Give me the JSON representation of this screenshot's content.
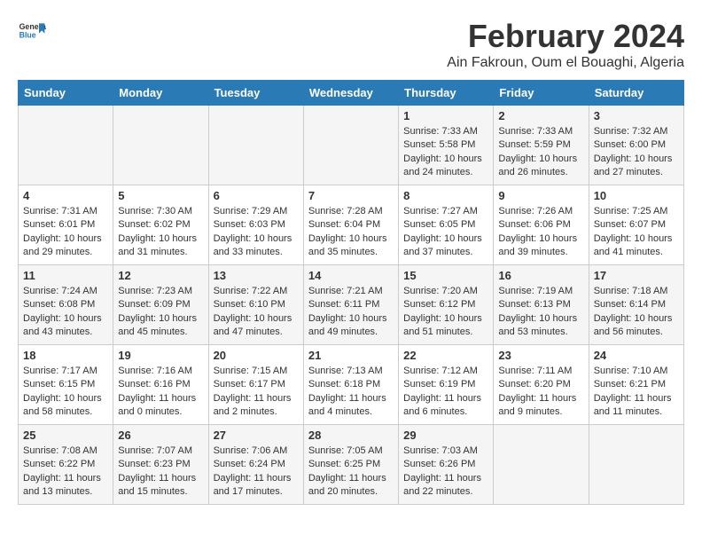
{
  "header": {
    "logo_general": "General",
    "logo_blue": "Blue",
    "title": "February 2024",
    "subtitle": "Ain Fakroun, Oum el Bouaghi, Algeria"
  },
  "weekdays": [
    "Sunday",
    "Monday",
    "Tuesday",
    "Wednesday",
    "Thursday",
    "Friday",
    "Saturday"
  ],
  "weeks": [
    [
      {
        "day": "",
        "sunrise": "",
        "sunset": "",
        "daylight": ""
      },
      {
        "day": "",
        "sunrise": "",
        "sunset": "",
        "daylight": ""
      },
      {
        "day": "",
        "sunrise": "",
        "sunset": "",
        "daylight": ""
      },
      {
        "day": "",
        "sunrise": "",
        "sunset": "",
        "daylight": ""
      },
      {
        "day": "1",
        "sunrise": "Sunrise: 7:33 AM",
        "sunset": "Sunset: 5:58 PM",
        "daylight": "Daylight: 10 hours and 24 minutes."
      },
      {
        "day": "2",
        "sunrise": "Sunrise: 7:33 AM",
        "sunset": "Sunset: 5:59 PM",
        "daylight": "Daylight: 10 hours and 26 minutes."
      },
      {
        "day": "3",
        "sunrise": "Sunrise: 7:32 AM",
        "sunset": "Sunset: 6:00 PM",
        "daylight": "Daylight: 10 hours and 27 minutes."
      }
    ],
    [
      {
        "day": "4",
        "sunrise": "Sunrise: 7:31 AM",
        "sunset": "Sunset: 6:01 PM",
        "daylight": "Daylight: 10 hours and 29 minutes."
      },
      {
        "day": "5",
        "sunrise": "Sunrise: 7:30 AM",
        "sunset": "Sunset: 6:02 PM",
        "daylight": "Daylight: 10 hours and 31 minutes."
      },
      {
        "day": "6",
        "sunrise": "Sunrise: 7:29 AM",
        "sunset": "Sunset: 6:03 PM",
        "daylight": "Daylight: 10 hours and 33 minutes."
      },
      {
        "day": "7",
        "sunrise": "Sunrise: 7:28 AM",
        "sunset": "Sunset: 6:04 PM",
        "daylight": "Daylight: 10 hours and 35 minutes."
      },
      {
        "day": "8",
        "sunrise": "Sunrise: 7:27 AM",
        "sunset": "Sunset: 6:05 PM",
        "daylight": "Daylight: 10 hours and 37 minutes."
      },
      {
        "day": "9",
        "sunrise": "Sunrise: 7:26 AM",
        "sunset": "Sunset: 6:06 PM",
        "daylight": "Daylight: 10 hours and 39 minutes."
      },
      {
        "day": "10",
        "sunrise": "Sunrise: 7:25 AM",
        "sunset": "Sunset: 6:07 PM",
        "daylight": "Daylight: 10 hours and 41 minutes."
      }
    ],
    [
      {
        "day": "11",
        "sunrise": "Sunrise: 7:24 AM",
        "sunset": "Sunset: 6:08 PM",
        "daylight": "Daylight: 10 hours and 43 minutes."
      },
      {
        "day": "12",
        "sunrise": "Sunrise: 7:23 AM",
        "sunset": "Sunset: 6:09 PM",
        "daylight": "Daylight: 10 hours and 45 minutes."
      },
      {
        "day": "13",
        "sunrise": "Sunrise: 7:22 AM",
        "sunset": "Sunset: 6:10 PM",
        "daylight": "Daylight: 10 hours and 47 minutes."
      },
      {
        "day": "14",
        "sunrise": "Sunrise: 7:21 AM",
        "sunset": "Sunset: 6:11 PM",
        "daylight": "Daylight: 10 hours and 49 minutes."
      },
      {
        "day": "15",
        "sunrise": "Sunrise: 7:20 AM",
        "sunset": "Sunset: 6:12 PM",
        "daylight": "Daylight: 10 hours and 51 minutes."
      },
      {
        "day": "16",
        "sunrise": "Sunrise: 7:19 AM",
        "sunset": "Sunset: 6:13 PM",
        "daylight": "Daylight: 10 hours and 53 minutes."
      },
      {
        "day": "17",
        "sunrise": "Sunrise: 7:18 AM",
        "sunset": "Sunset: 6:14 PM",
        "daylight": "Daylight: 10 hours and 56 minutes."
      }
    ],
    [
      {
        "day": "18",
        "sunrise": "Sunrise: 7:17 AM",
        "sunset": "Sunset: 6:15 PM",
        "daylight": "Daylight: 10 hours and 58 minutes."
      },
      {
        "day": "19",
        "sunrise": "Sunrise: 7:16 AM",
        "sunset": "Sunset: 6:16 PM",
        "daylight": "Daylight: 11 hours and 0 minutes."
      },
      {
        "day": "20",
        "sunrise": "Sunrise: 7:15 AM",
        "sunset": "Sunset: 6:17 PM",
        "daylight": "Daylight: 11 hours and 2 minutes."
      },
      {
        "day": "21",
        "sunrise": "Sunrise: 7:13 AM",
        "sunset": "Sunset: 6:18 PM",
        "daylight": "Daylight: 11 hours and 4 minutes."
      },
      {
        "day": "22",
        "sunrise": "Sunrise: 7:12 AM",
        "sunset": "Sunset: 6:19 PM",
        "daylight": "Daylight: 11 hours and 6 minutes."
      },
      {
        "day": "23",
        "sunrise": "Sunrise: 7:11 AM",
        "sunset": "Sunset: 6:20 PM",
        "daylight": "Daylight: 11 hours and 9 minutes."
      },
      {
        "day": "24",
        "sunrise": "Sunrise: 7:10 AM",
        "sunset": "Sunset: 6:21 PM",
        "daylight": "Daylight: 11 hours and 11 minutes."
      }
    ],
    [
      {
        "day": "25",
        "sunrise": "Sunrise: 7:08 AM",
        "sunset": "Sunset: 6:22 PM",
        "daylight": "Daylight: 11 hours and 13 minutes."
      },
      {
        "day": "26",
        "sunrise": "Sunrise: 7:07 AM",
        "sunset": "Sunset: 6:23 PM",
        "daylight": "Daylight: 11 hours and 15 minutes."
      },
      {
        "day": "27",
        "sunrise": "Sunrise: 7:06 AM",
        "sunset": "Sunset: 6:24 PM",
        "daylight": "Daylight: 11 hours and 17 minutes."
      },
      {
        "day": "28",
        "sunrise": "Sunrise: 7:05 AM",
        "sunset": "Sunset: 6:25 PM",
        "daylight": "Daylight: 11 hours and 20 minutes."
      },
      {
        "day": "29",
        "sunrise": "Sunrise: 7:03 AM",
        "sunset": "Sunset: 6:26 PM",
        "daylight": "Daylight: 11 hours and 22 minutes."
      },
      {
        "day": "",
        "sunrise": "",
        "sunset": "",
        "daylight": ""
      },
      {
        "day": "",
        "sunrise": "",
        "sunset": "",
        "daylight": ""
      }
    ]
  ]
}
